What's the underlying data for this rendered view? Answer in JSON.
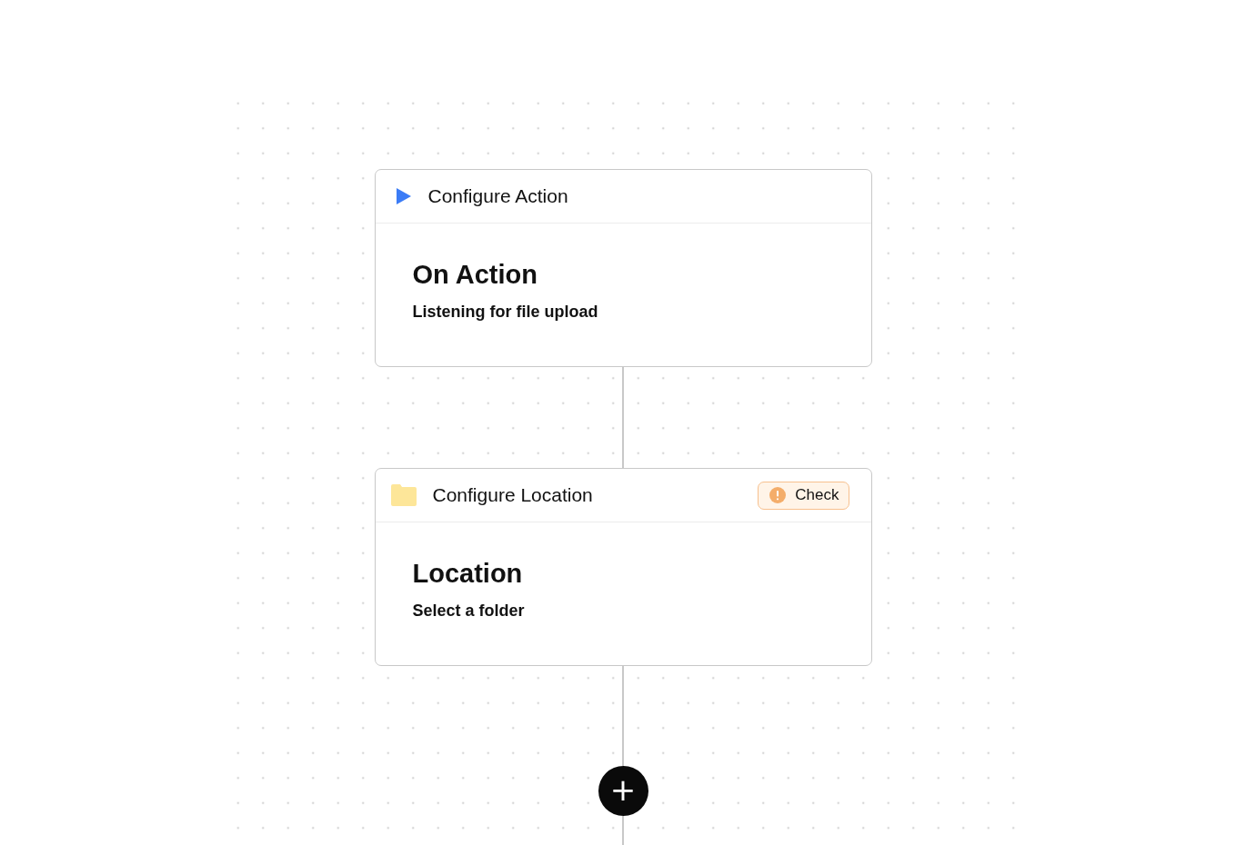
{
  "nodes": [
    {
      "kind": "trigger",
      "header": "Configure Action",
      "title": "On Action",
      "subtitle": "Listening for file upload"
    },
    {
      "kind": "folder",
      "header": "Configure Location",
      "badge": {
        "kind": "warning",
        "label": "Check"
      },
      "title": "Location",
      "subtitle": "Select a folder"
    }
  ],
  "add_button": {
    "label": "+"
  }
}
